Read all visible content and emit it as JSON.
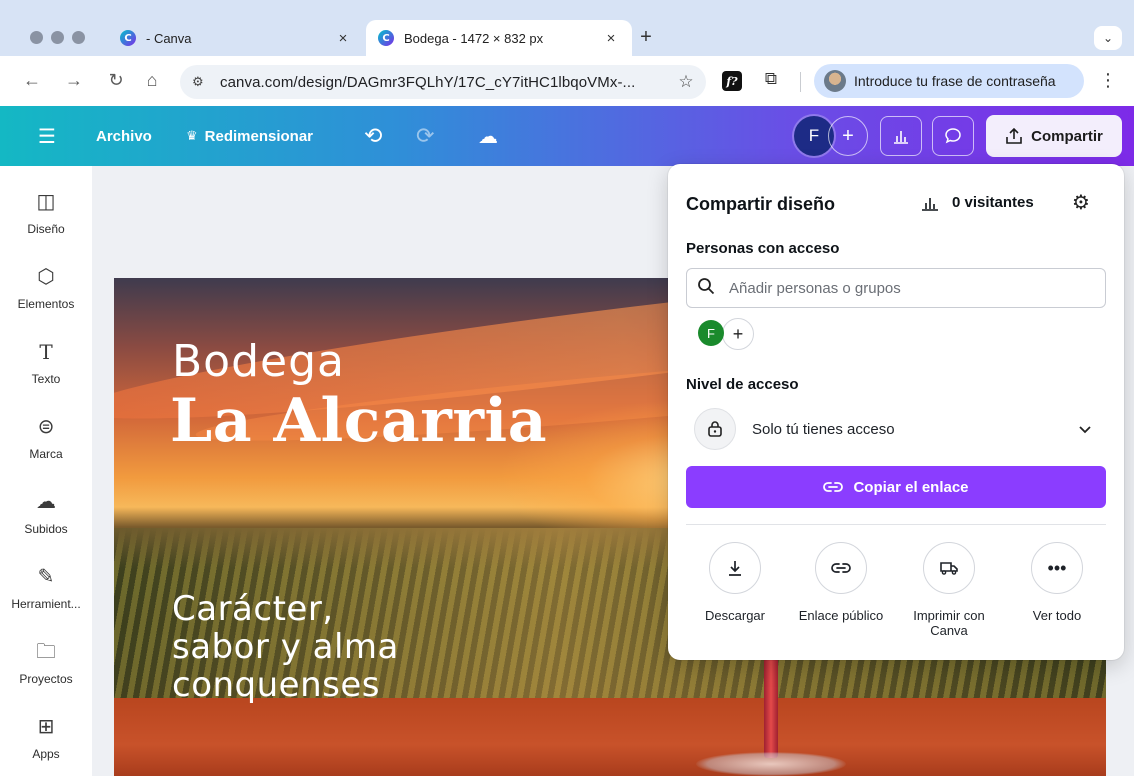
{
  "browser": {
    "tabs": [
      {
        "title": "- Canva",
        "favicon": "canva-icon",
        "active": false
      },
      {
        "title": "Bodega - 1472 × 832 px",
        "favicon": "canva-icon",
        "active": true
      }
    ],
    "new_tab": "+",
    "tab_close": "×",
    "url": "canva.com/design/DAGmr3FQLhY/17C_cY7itHC1lbqoVMx-...",
    "profile_prompt": "Introduce tu frase de contraseña",
    "ext_f": "f?"
  },
  "header": {
    "menu_label": "Archivo",
    "resize_label": "Redimensionar",
    "user_initial": "F",
    "share_label": "Compartir",
    "brand_gradient": [
      "#14b8c4",
      "#7d2ae8"
    ]
  },
  "sidebar": {
    "items": [
      {
        "label": "Diseño",
        "icon": "layout-icon"
      },
      {
        "label": "Elementos",
        "icon": "shapes-icon"
      },
      {
        "label": "Texto",
        "icon": "text-icon"
      },
      {
        "label": "Marca",
        "icon": "brand-icon"
      },
      {
        "label": "Subidos",
        "icon": "upload-icon"
      },
      {
        "label": "Herramient...",
        "icon": "tools-icon"
      },
      {
        "label": "Proyectos",
        "icon": "folder-icon"
      },
      {
        "label": "Apps",
        "icon": "apps-icon"
      }
    ]
  },
  "design": {
    "title_line1": "Bodega",
    "title_line2": "La Alcarria",
    "tagline_lines": [
      "Carácter,",
      "sabor y alma",
      "conquenses"
    ]
  },
  "share_panel": {
    "title": "Compartir diseño",
    "visitors": "0 visitantes",
    "people_label": "Personas con acceso",
    "search_placeholder": "Añadir personas o grupos",
    "avatar_initial": "F",
    "access_label": "Nivel de acceso",
    "access_value": "Solo tú tienes acceso",
    "copy_link": "Copiar el enlace",
    "accent_color": "#8b3dff",
    "actions": [
      {
        "label": "Descargar",
        "icon": "download-icon"
      },
      {
        "label": "Enlace público",
        "icon": "link-icon"
      },
      {
        "label": "Imprimir con Canva",
        "icon": "truck-icon"
      },
      {
        "label": "Ver todo",
        "icon": "more-icon"
      }
    ]
  }
}
